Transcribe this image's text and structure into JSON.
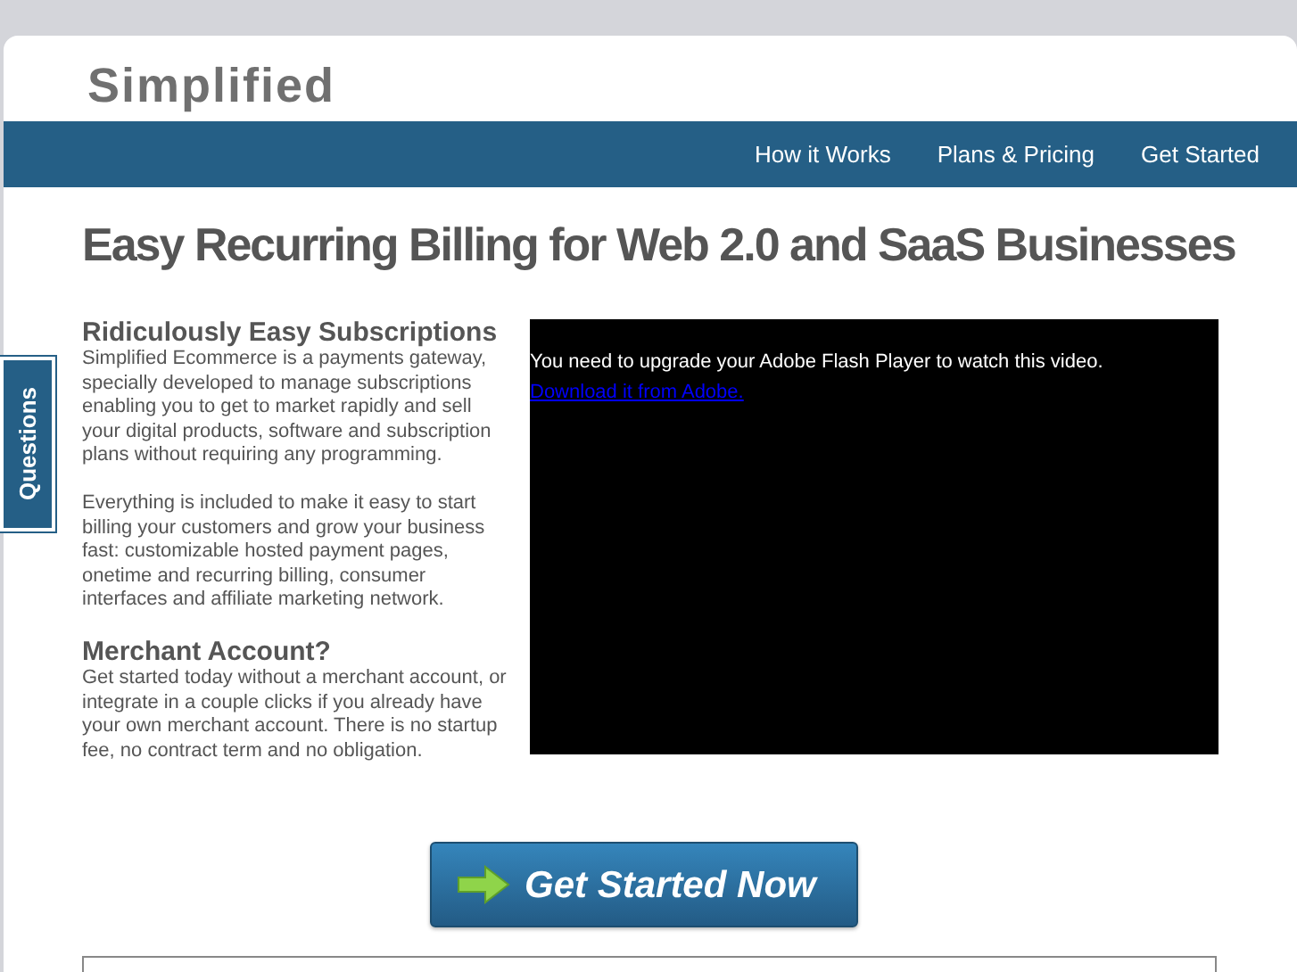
{
  "logo": "Simplified",
  "nav": [
    {
      "label": "How it Works"
    },
    {
      "label": "Plans & Pricing"
    },
    {
      "label": "Get Started"
    }
  ],
  "side_tab": "Questions",
  "headline": "Easy Recurring Billing for Web 2.0 and SaaS Businesses",
  "sections": [
    {
      "heading": "Ridiculously Easy Subscriptions",
      "paragraphs": [
        "Simplified Ecommerce is a payments gateway, specially developed to manage subscriptions enabling you to get to market rapidly and sell your digital products, software and subscription plans without requiring any programming.",
        "Everything is included to make it easy to start billing your customers and grow your business fast: customizable hosted payment pages, onetime and recurring billing, consumer interfaces and affiliate marketing network."
      ]
    },
    {
      "heading": "Merchant Account?",
      "paragraphs": [
        "Get started today without a merchant account, or integrate in a couple clicks if you already have your own merchant account. There is no startup fee, no contract term and no obligation."
      ]
    }
  ],
  "video": {
    "message": "You need to upgrade your Adobe Flash Player to watch this video.",
    "link": "Download it from Adobe."
  },
  "cta_button": "Get Started Now"
}
